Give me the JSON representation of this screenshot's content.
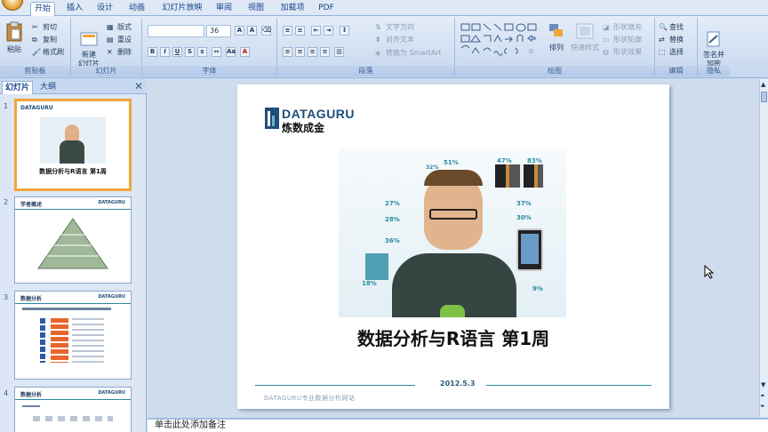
{
  "tabs": [
    "开始",
    "插入",
    "设计",
    "动画",
    "幻灯片放映",
    "审阅",
    "视图",
    "加载项",
    "PDF"
  ],
  "clipboard": {
    "paste": "粘贴",
    "cut": "剪切",
    "copy": "复制",
    "format_painter": "格式刷",
    "label": "剪贴板"
  },
  "slides_group": {
    "new_slide": "新建\n幻灯片",
    "layout": "版式",
    "reset": "重设",
    "delete": "删除",
    "label": "幻灯片"
  },
  "font_group": {
    "font_size": "36",
    "label": "字体"
  },
  "paragraph_group": {
    "text_direction": "文字方向",
    "align_text": "对齐文本",
    "smartart": "转换为 SmartArt",
    "label": "段落"
  },
  "drawing_group": {
    "arrange": "排列",
    "quick_styles": "快速样式",
    "shape_fill": "形状填充",
    "shape_outline": "形状轮廓",
    "shape_effects": "形状效果",
    "label": "绘图"
  },
  "editing_group": {
    "find": "查找",
    "replace": "替换",
    "select": "选择",
    "label": "编辑"
  },
  "privacy_group": {
    "sign": "签名并\n加密",
    "label": "隐私"
  },
  "pane_tabs": [
    "幻灯片",
    "大纲"
  ],
  "thumbnails": [
    {
      "num": "1",
      "title": "数据分析与R语言 第1周"
    },
    {
      "num": "2",
      "title": "学者概述"
    },
    {
      "num": "3",
      "title": "数据分析"
    },
    {
      "num": "4",
      "title": "数据分析"
    }
  ],
  "slide": {
    "logo_main": "DATAGURU",
    "logo_sub": "炼数成金",
    "title": "数据分析与R语言 第1周",
    "date": "2012.5.3",
    "footer": "DATAGURU专业数据分析网站",
    "stats": [
      "51%",
      "47%",
      "83%",
      "27%",
      "28%",
      "36%",
      "37%",
      "30%",
      "18%",
      "9%",
      "32%"
    ]
  },
  "notes_placeholder": "单击此处添加备注",
  "colors": {
    "accent": "#1f4e79",
    "orange": "#f1a53a",
    "teal": "#2b8aa0"
  }
}
